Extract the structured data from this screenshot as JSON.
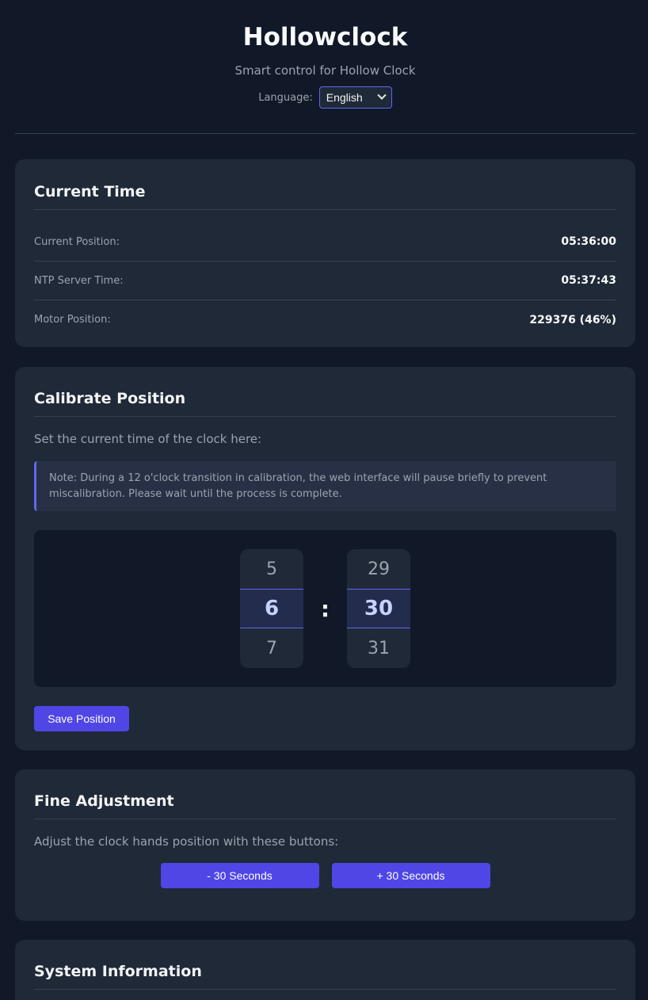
{
  "header": {
    "title": "Hollowclock",
    "subtitle": "Smart control for Hollow Clock",
    "language_label": "Language:",
    "language_selected": "English"
  },
  "current_time": {
    "title": "Current Time",
    "rows": [
      {
        "label": "Current Position:",
        "value": "05:36:00"
      },
      {
        "label": "NTP Server Time:",
        "value": "05:37:43"
      },
      {
        "label": "Motor Position:",
        "value": "229376 (46%)"
      }
    ]
  },
  "calibrate": {
    "title": "Calibrate Position",
    "description": "Set the current time of the clock here:",
    "note": "Note: During a 12 o'clock transition in calibration, the web interface will pause briefly to prevent miscalibration. Please wait until the process is complete.",
    "hours": {
      "prev": "5",
      "selected": "6",
      "next": "7"
    },
    "separator": ":",
    "minutes": {
      "prev": "29",
      "selected": "30",
      "next": "31"
    },
    "save_label": "Save Position"
  },
  "fine_adjust": {
    "title": "Fine Adjustment",
    "description": "Adjust the clock hands position with these buttons:",
    "minus_label": "- 30 Seconds",
    "plus_label": "+ 30 Seconds"
  },
  "system": {
    "title": "System Information"
  },
  "colors": {
    "background": "#111827",
    "card": "#1f2937",
    "accent": "#4f46e5"
  }
}
